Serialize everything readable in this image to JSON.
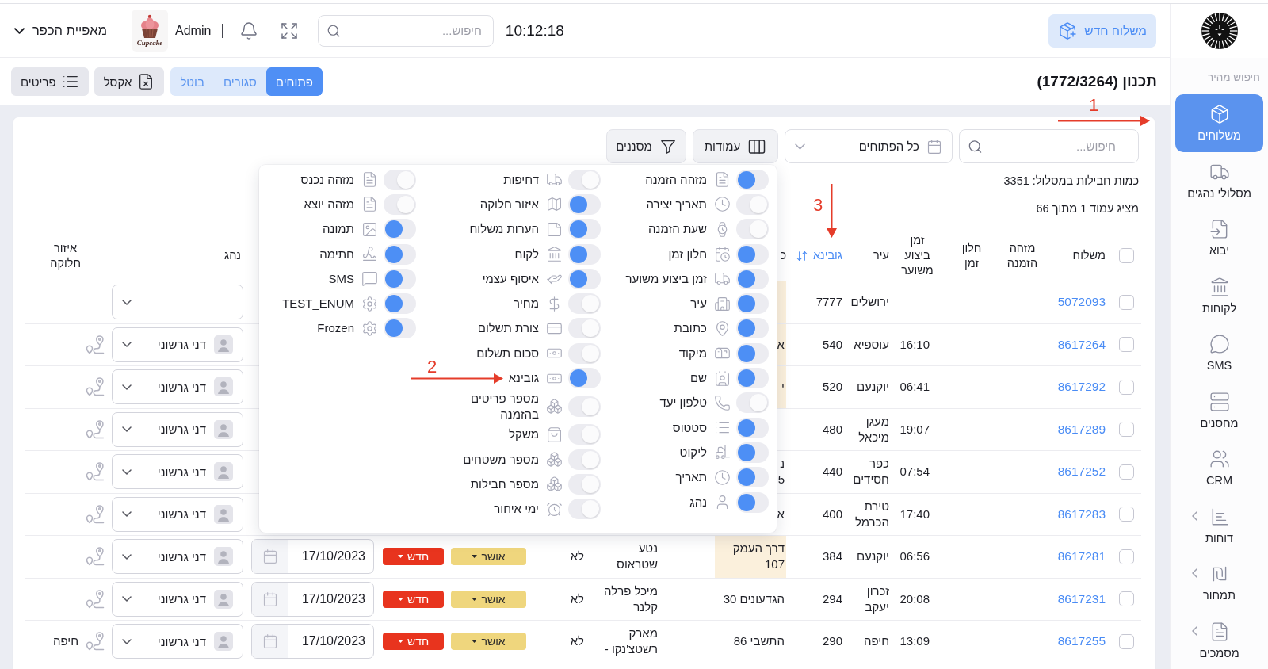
{
  "sidebar": {
    "quick_search": "חיפוש מהיר",
    "items": [
      {
        "label": "משלוחים",
        "selected": true,
        "submenu": false
      },
      {
        "label": "מסלולי נהגים",
        "selected": false,
        "submenu": false
      },
      {
        "label": "יבוא",
        "selected": false,
        "submenu": false
      },
      {
        "label": "לקוחות",
        "selected": false,
        "submenu": false
      },
      {
        "label": "SMS",
        "selected": false,
        "submenu": false
      },
      {
        "label": "מחסנים",
        "selected": false,
        "submenu": false
      },
      {
        "label": "CRM",
        "selected": false,
        "submenu": false
      },
      {
        "label": "דוחות",
        "selected": false,
        "submenu": true
      },
      {
        "label": "תמחור",
        "selected": false,
        "submenu": true
      },
      {
        "label": "מסמכים",
        "selected": false,
        "submenu": true
      }
    ]
  },
  "header": {
    "new_shipment": "משלוח חדש",
    "time": "10:12:18",
    "search": {
      "placeholder": "חיפוש..."
    },
    "user": "Admin",
    "logo_text": "Cupcake",
    "company": "מאפיית הכפר"
  },
  "page": {
    "title": "תכנון (1772/3264)",
    "status_tabs": [
      {
        "label": "פתוחים",
        "selected": true
      },
      {
        "label": "סגורים",
        "selected": false
      },
      {
        "label": "בוטל",
        "selected": false
      }
    ],
    "actions": [
      "אקסל",
      "פריטים"
    ]
  },
  "toolbar": {
    "search": {
      "placeholder": "חיפוש..."
    },
    "range": {
      "value": "כל הפתוחים"
    },
    "columns_button": "עמודות",
    "filters_button": "מסננים"
  },
  "summary": [
    "כמות חבילות במסלול: 3351",
    "מציג עמוד 1 מתוך 66"
  ],
  "columns_panel": {
    "groups": [
      {
        "items": [
          {
            "label": "מזהה הזמנה",
            "on": true
          },
          {
            "label": "תאריך יצירה",
            "on": false
          },
          {
            "label": "שעת הזמנה",
            "on": false
          },
          {
            "label": "חלון זמן",
            "on": true
          },
          {
            "label": "זמן ביצוע משוער",
            "on": true
          },
          {
            "label": "עיר",
            "on": true
          },
          {
            "label": "כתובת",
            "on": true
          },
          {
            "label": "מיקוד",
            "on": true
          },
          {
            "label": "שם",
            "on": true
          },
          {
            "label": "טלפון יעד",
            "on": false
          },
          {
            "label": "סטטוס",
            "on": true
          },
          {
            "label": "ליקוט",
            "on": true
          },
          {
            "label": "תאריך",
            "on": true
          },
          {
            "label": "נהג",
            "on": true
          }
        ]
      },
      {
        "items": [
          {
            "label": "דחיפות",
            "on": false
          },
          {
            "label": "איזור חלוקה",
            "on": true
          },
          {
            "label": "הערות משלוח",
            "on": true
          },
          {
            "label": "לקוח",
            "on": true
          },
          {
            "label": "איסוף עצמי",
            "on": true
          },
          {
            "label": "מחיר",
            "on": false
          },
          {
            "label": "צורת תשלום",
            "on": false
          },
          {
            "label": "סכום תשלום",
            "on": false
          },
          {
            "label": "גובינא",
            "on": true
          },
          {
            "label": "מספר פריטים בהזמנה",
            "on": false
          },
          {
            "label": "משקל",
            "on": false
          },
          {
            "label": "מספר משטחים",
            "on": false
          },
          {
            "label": "מספר חבילות",
            "on": false
          },
          {
            "label": "ימי איחור",
            "on": false
          }
        ]
      },
      {
        "items": [
          {
            "label": "מזהה נכנס",
            "on": false
          },
          {
            "label": "מזהה יוצא",
            "on": false
          },
          {
            "label": "תמונה",
            "on": true
          },
          {
            "label": "חתימה",
            "on": true
          },
          {
            "label": "SMS",
            "on": true
          },
          {
            "label": "TEST_ENUM",
            "on": true
          },
          {
            "label": "Frozen",
            "on": true
          }
        ]
      }
    ]
  },
  "table": {
    "select_all_checked": false,
    "header": {
      "shipment": {
        "label": "משלוח",
        "sorted": false
      },
      "order_id": {
        "label": "מזהה הזמנה",
        "sorted": false
      },
      "time_window": {
        "label": "חלון זמן",
        "sorted": false
      },
      "estimated_time": {
        "label": "זמן ביצוע משוער",
        "sorted": false
      },
      "city": {
        "label": "עיר",
        "sorted": false
      },
      "gubina": {
        "label": "גובינא",
        "sorted": true
      },
      "column_8": {
        "label": "כ",
        "sorted": false
      },
      "driver": {
        "label": "נהג",
        "sorted": false
      },
      "zone": {
        "label": "איזור חלוקה",
        "sorted": false
      }
    },
    "rows": [
      {
        "checked": false,
        "shipment": "5072093",
        "city": "ירושלים",
        "gubina": "7777",
        "highlighted": true,
        "route": false
      },
      {
        "checked": false,
        "shipment": "8617264",
        "estimated_time": "16:10",
        "city": "עוספיא",
        "gubina": "540",
        "column_8": "א",
        "highlighted": true,
        "driver": "דני גרשוני",
        "route": true
      },
      {
        "checked": false,
        "shipment": "8617292",
        "estimated_time": "06:41",
        "city": "יוקנעם",
        "gubina": "520",
        "column_8": "י",
        "highlighted": true,
        "driver": "דני גרשוני",
        "route": true
      },
      {
        "checked": false,
        "shipment": "8617289",
        "estimated_time": "19:07",
        "city": "מעגן מיכאל",
        "gubina": "480",
        "highlighted": false,
        "driver": "דני גרשוני",
        "route": true
      },
      {
        "checked": false,
        "shipment": "8617252",
        "estimated_time": "07:54",
        "city": "כפר חסידים",
        "gubina": "440",
        "column_8": "נ\n5",
        "highlighted": false,
        "driver": "דני גרשוני",
        "route": true
      },
      {
        "checked": false,
        "shipment": "8617283",
        "estimated_time": "17:40",
        "city": "טירת הכרמל",
        "gubina": "400",
        "column_8": "א",
        "highlighted": false,
        "driver": "דני גרשוני",
        "route": true
      },
      {
        "checked": false,
        "shipment": "8617281",
        "estimated_time": "06:56",
        "city": "יוקנעם",
        "gubina": "384",
        "column_8": "דרך העמק 107",
        "highlighted": true,
        "column_9": "נטע שטראוס",
        "column_10": "לא",
        "column_11": "אושר",
        "column_12": "חדש",
        "column_13": "17/10/2023",
        "driver": "דני גרשוני",
        "route": true
      },
      {
        "checked": false,
        "shipment": "8617231",
        "estimated_time": "20:08",
        "city": "זכרון יעקב",
        "gubina": "294",
        "column_8": "הגדעונים 30",
        "highlighted": false,
        "column_9": "מיכל פרלה קלנר",
        "column_10": "לא",
        "column_11": "אושר",
        "column_12": "חדש",
        "column_13": "17/10/2023",
        "driver": "דני גרשוני",
        "route": true
      },
      {
        "checked": false,
        "shipment": "8617255",
        "estimated_time": "13:09",
        "city": "חיפה",
        "gubina": "290",
        "column_8": "התשבי 86",
        "highlighted": false,
        "column_9": "מארק רשטצ'נקו -",
        "column_10": "לא",
        "column_11": "אושר",
        "column_12": "חדש",
        "column_13": "17/10/2023",
        "driver": "דני גרשוני",
        "route": true,
        "zone": "חיפה"
      }
    ]
  },
  "annotations": [
    {
      "label": "1"
    },
    {
      "label": "2"
    },
    {
      "label": "3"
    }
  ]
}
